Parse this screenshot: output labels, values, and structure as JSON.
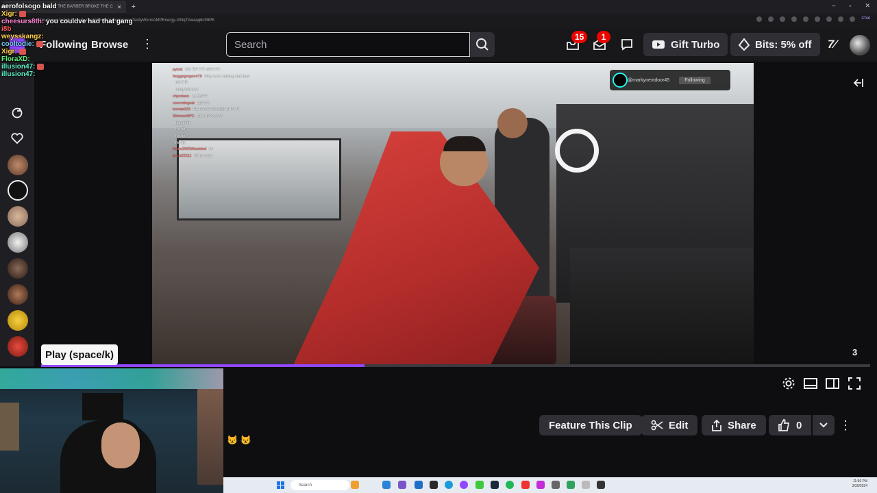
{
  "browser": {
    "tab_title": "HOW THE BARBER BROKE THE C",
    "url": "https://www.twitch.tv/markynextdoor/clip/AbstemiousTardyWormAMPEnergy-iXNqTAwaqq6c99PE",
    "chat_ext_label": "Chat"
  },
  "overlay_chat": [
    {
      "user": "aerofolso",
      "msg": "go bald",
      "color": "#ffffff"
    },
    {
      "user": "Xigr:",
      "msg": "",
      "color": "#ffd24d"
    },
    {
      "user": "cheesurs8th:",
      "msg": "you couldve had that gang",
      "color": "#ff8ad8"
    },
    {
      "user": "i8b",
      "msg": "",
      "color": "#ff5b5b"
    },
    {
      "user": "weysskangz:",
      "msg": "",
      "color": "#ffd24d"
    },
    {
      "user": "cooltodie:",
      "msg": "",
      "color": "#7fd3ff"
    },
    {
      "user": "Xigr:",
      "msg": "",
      "color": "#ffd24d"
    },
    {
      "user": "FloraXD:",
      "msg": "",
      "color": "#5ef07a"
    },
    {
      "user": "illusion47:",
      "msg": "",
      "color": "#5ef0c8"
    },
    {
      "user": "illusion47:",
      "msg": "",
      "color": "#5ef0c8"
    }
  ],
  "nav": {
    "following": "Following",
    "browse": "Browse",
    "search_placeholder": "Search",
    "inbox_badge": "15",
    "whispers_badge": "1",
    "gift_turbo": "Gift Turbo",
    "bits": "Bits: 5% off"
  },
  "video": {
    "tiktok_handle": "@markynextdoor45",
    "tiktok_follow": "Following",
    "ingame_chat": [
      {
        "user": "pyloid",
        "msg": "NO TIP ??? WHY?!?"
      },
      {
        "user": "Noggegorgon479",
        "msg": "Why is he making that face"
      },
      {
        "user": "",
        "msg": "NO TIP"
      },
      {
        "user": "",
        "msg": "Long lost dad"
      },
      {
        "user": "chjordann",
        "msg": "no tip???"
      },
      {
        "user": "concretegoat",
        "msg": "20????"
      },
      {
        "user": "tooraw023",
        "msg": "HE GAVE HIM $50 CHATTT"
      },
      {
        "user": "SlimmerNPC",
        "msg": "NO TIP??????"
      },
      {
        "user": "",
        "msg": "big ahhh"
      },
      {
        "user": "",
        "msg": "No tip?"
      },
      {
        "user": "",
        "msg": "No tip"
      },
      {
        "user": "",
        "msg": "No tip"
      },
      {
        "user": "Metro2600Wastelnd",
        "msg": "lol"
      },
      {
        "user": "jacob22111",
        "msg": "50 is crazy"
      },
      {
        "user": "",
        "msg": ""
      }
    ]
  },
  "player": {
    "tooltip": "Play (space/k)",
    "time": "3",
    "progress": 0.39
  },
  "actions": {
    "feature": "Feature This Clip",
    "edit": "Edit",
    "share": "Share",
    "like_count": "0"
  },
  "taskbar": {
    "search": "Search",
    "time": "11:56 PM",
    "date": "3/30/2024"
  },
  "colors": {
    "accent": "#9147ff",
    "badge": "#eb0400",
    "surface": "#2f2f35",
    "background": "#0e0e10"
  }
}
